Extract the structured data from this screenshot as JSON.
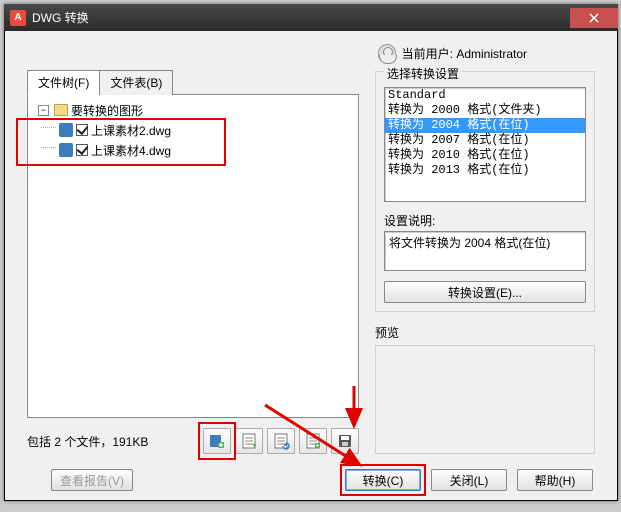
{
  "title": "DWG 转换",
  "user_label": "当前用户",
  "user_name": "Administrator",
  "tabs": {
    "tree": "文件树(F)",
    "table": "文件表(B)"
  },
  "tree": {
    "root": "要转换的图形",
    "files": [
      "上课素材2.dwg",
      "上课素材4.dwg"
    ]
  },
  "status": "包括 2 个文件，191KB",
  "settings": {
    "legend": "选择转换设置",
    "options": [
      "Standard",
      "转换为 2000 格式(文件夹)",
      "转换为 2004 格式(在位)",
      "转换为 2007 格式(在位)",
      "转换为 2010 格式(在位)",
      "转换为 2013 格式(在位)"
    ],
    "selected_index": 2,
    "desc_label": "设置说明:",
    "desc_text": "将文件转换为 2004 格式(在位)",
    "settings_btn": "转换设置(E)..."
  },
  "preview_label": "预览",
  "footer": {
    "report": "查看报告(V)",
    "convert": "转换(C)",
    "close": "关闭(L)",
    "help": "帮助(H)"
  }
}
